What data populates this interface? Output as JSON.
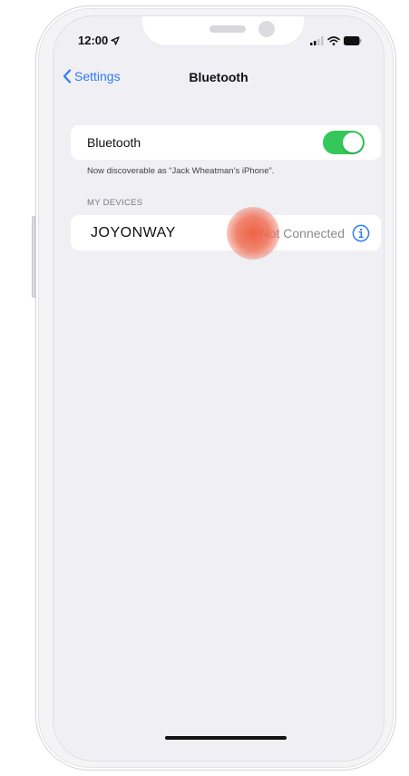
{
  "status_bar": {
    "time": "12:00"
  },
  "nav": {
    "back_label": "Settings",
    "title": "Bluetooth"
  },
  "bluetooth": {
    "label": "Bluetooth",
    "enabled": true,
    "discoverable_text": "Now discoverable as “Jack Wheatman’s iPhone”."
  },
  "my_devices": {
    "header": "MY DEVICES",
    "devices": [
      {
        "name": "JOYONWAY",
        "status": "Not Connected"
      }
    ]
  },
  "colors": {
    "accent": "#2f7cf6",
    "toggle_on": "#34c759",
    "background": "#efeff4",
    "tap_indicator": "#ec5a3c"
  }
}
